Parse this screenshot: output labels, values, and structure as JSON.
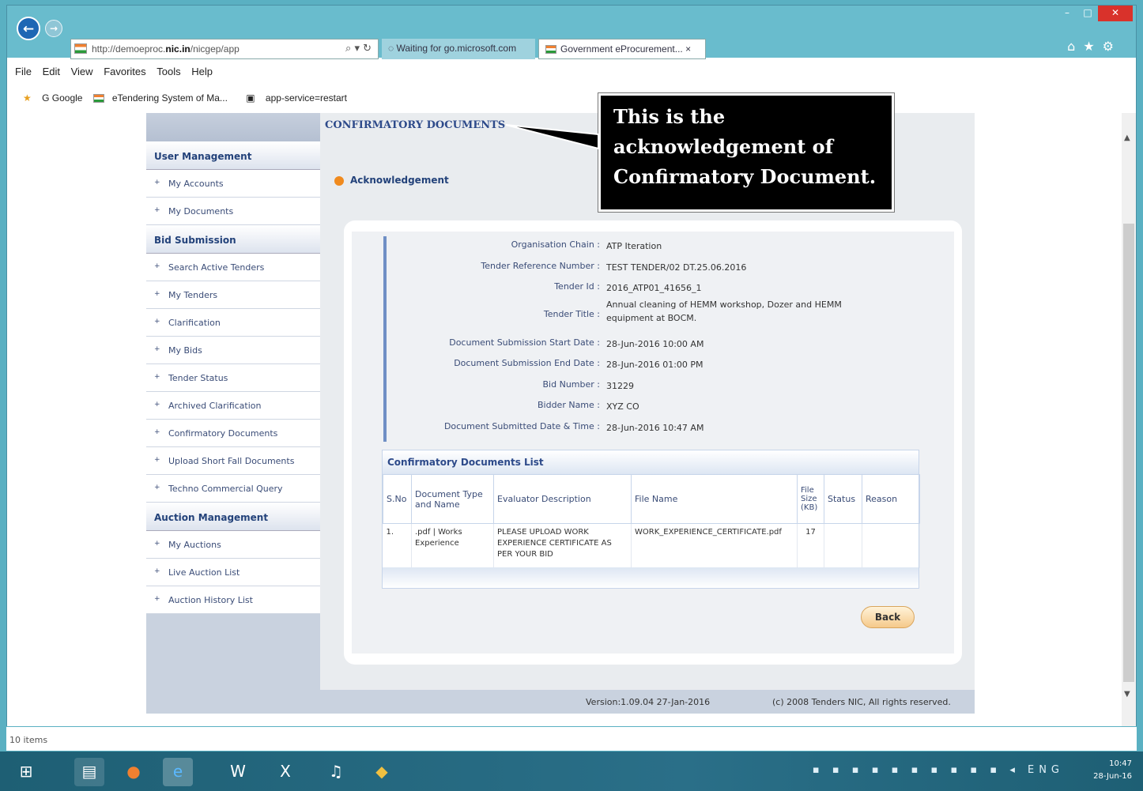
{
  "browser": {
    "url_prefix": "http://demoeproc.",
    "url_bold": "nic.in",
    "url_suffix": "/nicgep/app",
    "url_controls": "⌕ ▾ ↻",
    "tab1_title": "Waiting for go.microsoft.com",
    "tab2_title": "Government eProcurement... ×",
    "menu": [
      "File",
      "Edit",
      "View",
      "Favorites",
      "Tools",
      "Help"
    ],
    "favorites": [
      "G Google",
      "eTendering System of Ma...",
      "app-service=restart"
    ],
    "status_text": "10 items"
  },
  "nav": {
    "sections": [
      {
        "title": "User Management",
        "items": [
          "My Accounts",
          "My Documents"
        ]
      },
      {
        "title": "Bid Submission",
        "items": [
          "Search Active Tenders",
          "My Tenders",
          "Clarification",
          "My Bids",
          "Tender Status",
          "Archived Clarification",
          "Confirmatory Documents",
          "Upload Short Fall Documents",
          "Techno Commercial Query"
        ]
      },
      {
        "title": "Auction Management",
        "items": [
          "My Auctions",
          "Live Auction List",
          "Auction History List"
        ]
      }
    ]
  },
  "main": {
    "page_title": "CONFIRMATORY DOCUMENTS",
    "ack_label": "Acknowledgement",
    "details": [
      {
        "label": "Organisation Chain :",
        "value": "ATP Iteration"
      },
      {
        "label": "Tender Reference Number :",
        "value": "TEST TENDER/02 DT.25.06.2016"
      },
      {
        "label": "Tender Id :",
        "value": "2016_ATP01_41656_1"
      },
      {
        "label": "Tender Title :",
        "value": "Annual cleaning of HEMM workshop, Dozer and HEMM equipment at BOCM."
      },
      {
        "label": "Document Submission Start Date :",
        "value": "28-Jun-2016 10:00 AM"
      },
      {
        "label": "Document Submission End Date :",
        "value": "28-Jun-2016 01:00 PM"
      },
      {
        "label": "Bid Number :",
        "value": "31229"
      },
      {
        "label": "Bidder Name :",
        "value": "XYZ CO"
      },
      {
        "label": "Document Submitted Date & Time :",
        "value": "28-Jun-2016 10:47 AM"
      }
    ],
    "cdl_title": "Confirmatory Documents List",
    "columns": [
      "S.No",
      "Document Type and Name",
      "Evaluator Description",
      "File Name",
      "File Size (KB)",
      "Status",
      "Reason"
    ],
    "rows": [
      [
        "1.",
        ".pdf | Works Experience",
        "PLEASE UPLOAD WORK EXPERIENCE CERTIFICATE AS PER YOUR BID",
        "WORK_EXPERIENCE_CERTIFICATE.pdf",
        "17",
        "",
        ""
      ]
    ],
    "back_label": "Back"
  },
  "footer": {
    "version": "Version:1.09.04 27-Jan-2016",
    "copyright": "(c) 2008 Tenders NIC, All rights reserved."
  },
  "callout": {
    "line1": "This is the",
    "line2": "acknowledgement of",
    "line3": "Confirmatory Document."
  },
  "taskbar": {
    "lang": "ENG",
    "time": "10:47",
    "date": "28-Jun-16"
  }
}
